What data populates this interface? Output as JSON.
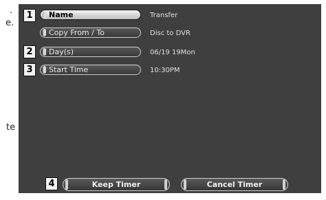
{
  "side_text": [
    ".",
    "e.",
    "te"
  ],
  "rows": [
    {
      "number": "1",
      "label": "Name",
      "value": "Transfer"
    },
    {
      "number": "",
      "label": "Copy From / To",
      "value": "Disc to DVR"
    },
    {
      "number": "2",
      "label": "Day(s)",
      "value": "06/19  19Mon"
    },
    {
      "number": "3",
      "label": "Start Time",
      "value": "10:30PM"
    }
  ],
  "buttons": {
    "number": "4",
    "keep_label": "Keep Timer",
    "cancel_label": "Cancel Timer"
  }
}
